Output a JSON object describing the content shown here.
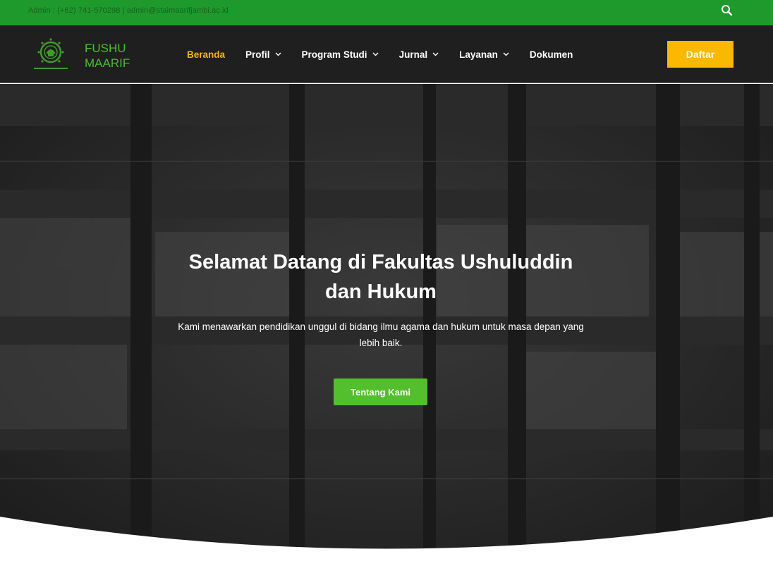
{
  "topbar": {
    "contact": "Admin : (+62) 741-570298 | admin@staimaarifjambi.ac.id",
    "search_icon": "search-icon"
  },
  "brand": {
    "line1": "FUSHU",
    "line2": "MAARIF",
    "logo_icon": "institution-seal-logo"
  },
  "nav": {
    "items": [
      {
        "label": "Beranda",
        "active": true,
        "has_dropdown": false
      },
      {
        "label": "Profil",
        "active": false,
        "has_dropdown": true
      },
      {
        "label": "Program Studi",
        "active": false,
        "has_dropdown": true
      },
      {
        "label": "Jurnal",
        "active": false,
        "has_dropdown": true
      },
      {
        "label": "Layanan",
        "active": false,
        "has_dropdown": true
      },
      {
        "label": "Dokumen",
        "active": false,
        "has_dropdown": false
      }
    ],
    "cta_label": "Daftar"
  },
  "hero": {
    "title_line1": "Selamat Datang di Fakultas Ushuluddin",
    "title_line2": "dan Hukum",
    "subtitle_line1": "Kami menawarkan pendidikan unggul di bidang ilmu agama dan hukum untuk masa depan yang",
    "subtitle_line2": "lebih baik.",
    "button_label": "Tentang Kami"
  },
  "colors": {
    "topbar": "#1e9a2c",
    "header": "#1f1f1f",
    "brand_green": "#4cbb2f",
    "active_nav": "#f5b800",
    "cta": "#fbb800",
    "hero_button": "#53bf2c"
  }
}
